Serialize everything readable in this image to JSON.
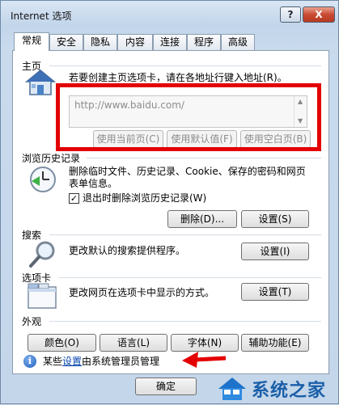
{
  "window": {
    "title": "Internet 选项",
    "help_glyph": "?",
    "close_glyph": "X"
  },
  "tabs": [
    {
      "label": "常规",
      "active": true
    },
    {
      "label": "安全"
    },
    {
      "label": "隐私"
    },
    {
      "label": "内容"
    },
    {
      "label": "连接"
    },
    {
      "label": "程序"
    },
    {
      "label": "高级"
    }
  ],
  "home": {
    "section": "主页",
    "description": "若要创建主页选项卡，请在各地址行键入地址(R)。",
    "url_value": "http://www.baidu.com/",
    "btn_current": "使用当前页(C)",
    "btn_default": "使用默认值(F)",
    "btn_blank": "使用空白页(B)"
  },
  "history": {
    "section": "浏览历史记录",
    "description_line1": "删除临时文件、历史记录、Cookie、保存的密码和网页",
    "description_line2": "表单信息。",
    "checkbox_label": "退出时删除浏览历史记录(W)",
    "checkbox_mark": "✓",
    "btn_delete": "删除(D)...",
    "btn_settings": "设置(S)"
  },
  "search": {
    "section": "搜索",
    "description": "更改默认的搜索提供程序。",
    "btn_settings": "设置(I)"
  },
  "tabs_section": {
    "section": "选项卡",
    "description": "更改网页在选项卡中显示的方式。",
    "btn_settings": "设置(T)"
  },
  "appearance": {
    "section": "外观",
    "btn_colors": "颜色(O)",
    "btn_languages": "语言(L)",
    "btn_fonts": "字体(N)",
    "btn_accessibility": "辅助功能(E)"
  },
  "notice": {
    "prefix": "某些",
    "link": "设置",
    "suffix": "由系统管理员管理",
    "icon_glyph": "i"
  },
  "footer": {
    "ok": "确定"
  },
  "watermark": {
    "text": "系统之家"
  },
  "colors": {
    "highlight_box": "#e30000",
    "arrow": "#e30000"
  }
}
